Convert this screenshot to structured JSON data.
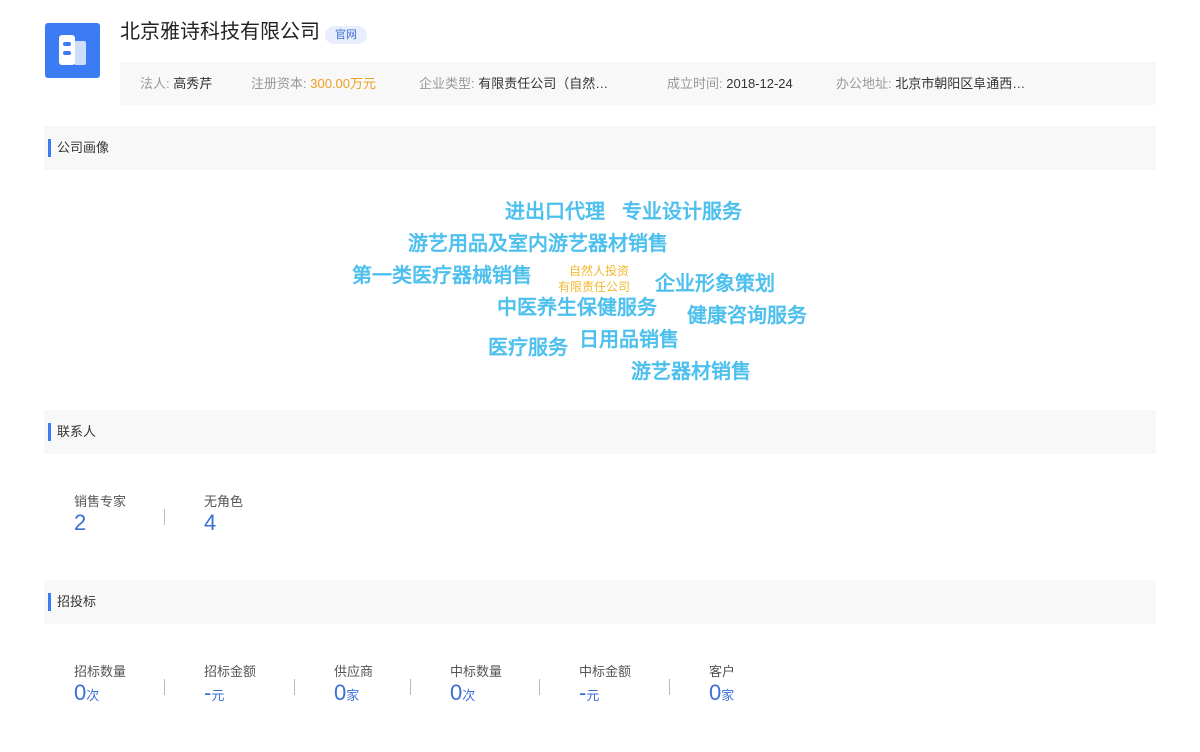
{
  "company": {
    "name": "北京雅诗科技有限公司",
    "official_badge": "官网",
    "logo_icon": "building-icon",
    "brand_color": "#3b7cf5"
  },
  "info": {
    "legal_person_label": "法人:",
    "legal_person": "高秀芹",
    "capital_label": "注册资本:",
    "capital": "300.00万元",
    "type_label": "企业类型:",
    "type": "有限责任公司（自然…",
    "founded_label": "成立时间:",
    "founded": "2018-12-24",
    "address_label": "办公地址:",
    "address": "北京市朝阳区阜通西…"
  },
  "sections": {
    "portrait": "公司画像",
    "contacts": "联系人",
    "bidding": "招投标"
  },
  "word_cloud": {
    "words": [
      "进出口代理",
      "专业设计服务",
      "游艺用品及室内游艺器材销售",
      "第一类医疗器械销售",
      "企业形象策划",
      "中医养生保健服务",
      "健康咨询服务",
      "医疗服务",
      "日用品销售",
      "游艺器材销售"
    ],
    "small_words": [
      "自然人投资",
      "有限责任公司"
    ]
  },
  "contacts": [
    {
      "label": "销售专家",
      "value": "2"
    },
    {
      "label": "无角色",
      "value": "4"
    }
  ],
  "bidding": [
    {
      "label": "招标数量",
      "value": "0",
      "unit": "次"
    },
    {
      "label": "招标金额",
      "value": "-",
      "unit": "元"
    },
    {
      "label": "供应商",
      "value": "0",
      "unit": "家"
    },
    {
      "label": "中标数量",
      "value": "0",
      "unit": "次"
    },
    {
      "label": "中标金额",
      "value": "-",
      "unit": "元"
    },
    {
      "label": "客户",
      "value": "0",
      "unit": "家"
    }
  ]
}
